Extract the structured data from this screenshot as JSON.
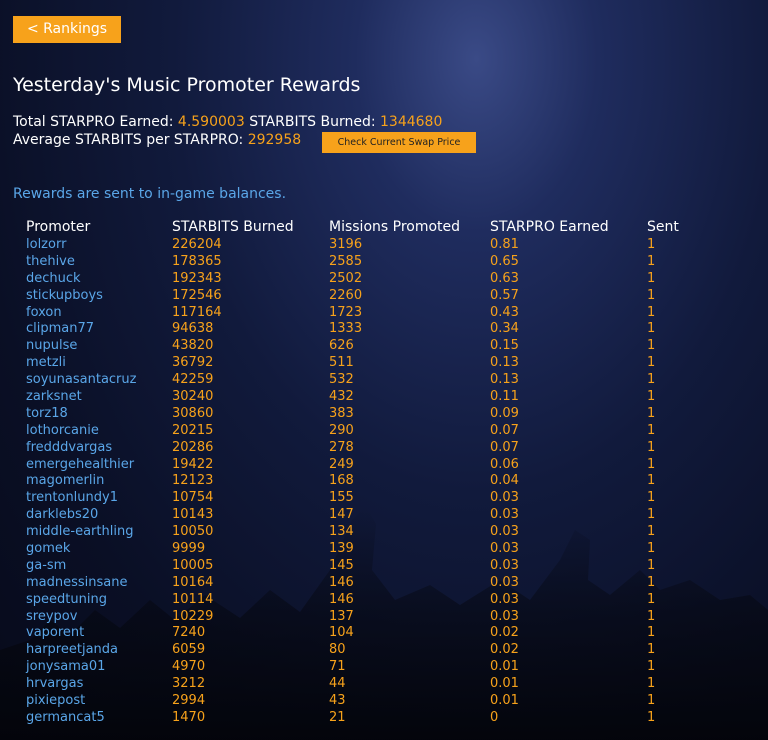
{
  "nav": {
    "back_label": "< Rankings"
  },
  "title": "Yesterday's Music Promoter Rewards",
  "summary": {
    "total_label": "Total STARPRO Earned:",
    "total_value": "4.590003",
    "burned_label": "STARBITS Burned:",
    "burned_value": "1344680",
    "average_label": "Average STARBITS per STARPRO:",
    "average_value": "292958",
    "swap_button_label": "Check Current Swap Price"
  },
  "note": "Rewards are sent to in-game balances.",
  "table": {
    "columns": [
      "Promoter",
      "STARBITS Burned",
      "Missions Promoted",
      "STARPRO Earned",
      "Sent"
    ],
    "rows": [
      [
        "lolzorr",
        "226204",
        "3196",
        "0.81",
        "1"
      ],
      [
        "thehive",
        "178365",
        "2585",
        "0.65",
        "1"
      ],
      [
        "dechuck",
        "192343",
        "2502",
        "0.63",
        "1"
      ],
      [
        "stickupboys",
        "172546",
        "2260",
        "0.57",
        "1"
      ],
      [
        "foxon",
        "117164",
        "1723",
        "0.43",
        "1"
      ],
      [
        "clipman77",
        "94638",
        "1333",
        "0.34",
        "1"
      ],
      [
        "nupulse",
        "43820",
        "626",
        "0.15",
        "1"
      ],
      [
        "metzli",
        "36792",
        "511",
        "0.13",
        "1"
      ],
      [
        "soyunasantacruz",
        "42259",
        "532",
        "0.13",
        "1"
      ],
      [
        "zarksnet",
        "30240",
        "432",
        "0.11",
        "1"
      ],
      [
        "torz18",
        "30860",
        "383",
        "0.09",
        "1"
      ],
      [
        "lothorcanie",
        "20215",
        "290",
        "0.07",
        "1"
      ],
      [
        "fredddvargas",
        "20286",
        "278",
        "0.07",
        "1"
      ],
      [
        "emergehealthier",
        "19422",
        "249",
        "0.06",
        "1"
      ],
      [
        "magomerlin",
        "12123",
        "168",
        "0.04",
        "1"
      ],
      [
        "trentonlundy1",
        "10754",
        "155",
        "0.03",
        "1"
      ],
      [
        "darklebs20",
        "10143",
        "147",
        "0.03",
        "1"
      ],
      [
        "middle-earthling",
        "10050",
        "134",
        "0.03",
        "1"
      ],
      [
        "gomek",
        "9999",
        "139",
        "0.03",
        "1"
      ],
      [
        "ga-sm",
        "10005",
        "145",
        "0.03",
        "1"
      ],
      [
        "madnessinsane",
        "10164",
        "146",
        "0.03",
        "1"
      ],
      [
        "speedtuning",
        "10114",
        "146",
        "0.03",
        "1"
      ],
      [
        "sreypov",
        "10229",
        "137",
        "0.03",
        "1"
      ],
      [
        "vaporent",
        "7240",
        "104",
        "0.02",
        "1"
      ],
      [
        "harpreetjanda",
        "6059",
        "80",
        "0.02",
        "1"
      ],
      [
        "jonysama01",
        "4970",
        "71",
        "0.01",
        "1"
      ],
      [
        "hrvargas",
        "3212",
        "44",
        "0.01",
        "1"
      ],
      [
        "pixiepost",
        "2994",
        "43",
        "0.01",
        "1"
      ],
      [
        "germancat5",
        "1470",
        "21",
        "0",
        "1"
      ]
    ]
  },
  "colors": {
    "accent": "#f7a21b",
    "link": "#5aa6e8",
    "text": "#ffffff"
  }
}
